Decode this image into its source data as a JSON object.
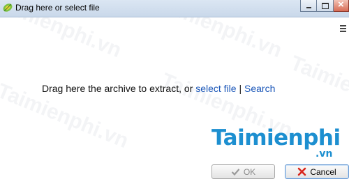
{
  "window": {
    "title": "Drag here or select file"
  },
  "main": {
    "prompt_text": "Drag here the archive to extract, or ",
    "select_link": "select file",
    "separator": " | ",
    "search_link": "Search"
  },
  "footer": {
    "ok_label": "OK",
    "cancel_label": "Cancel"
  },
  "watermark": {
    "brand": "Taimienphi",
    "brand_suffix": ".vn",
    "tiled_text": "Taimienphi.vn"
  },
  "colors": {
    "link": "#1a56b8",
    "brand": "#1d8fd0",
    "close_button": "#d86c55"
  },
  "icons": {
    "app": "leaf-icon",
    "ok": "check-icon",
    "cancel": "x-icon",
    "menu": "hamburger-icon"
  }
}
